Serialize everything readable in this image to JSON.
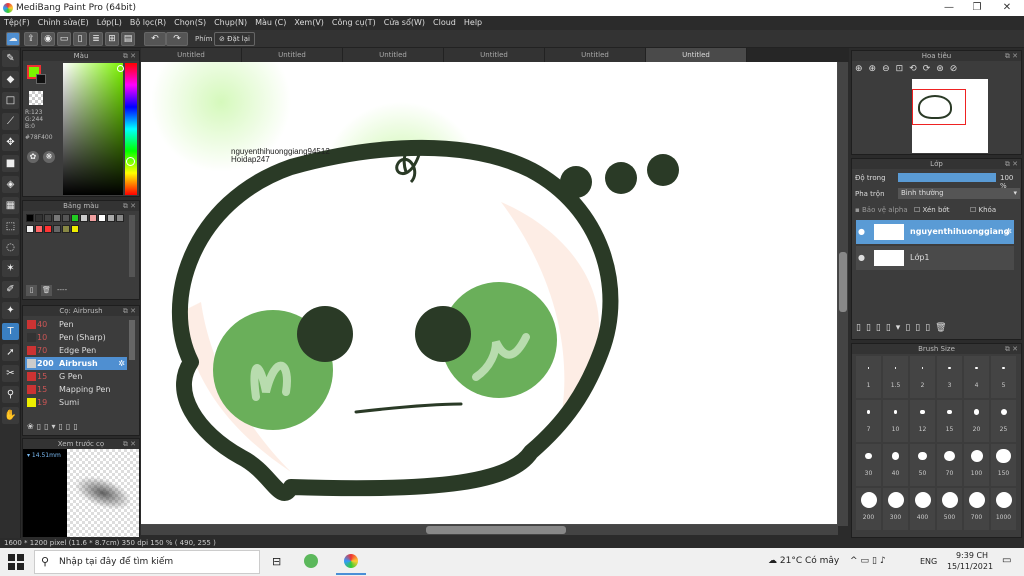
{
  "window": {
    "title": "MediBang Paint Pro (64bit)"
  },
  "menu": [
    "Tệp(F)",
    "Chỉnh sửa(E)",
    "Lớp(L)",
    "Bộ lọc(R)",
    "Chọn(S)",
    "Chụp(N)",
    "Màu (C)",
    "Xem(V)",
    "Công cụ(T)",
    "Cửa sổ(W)",
    "Cloud",
    "Help"
  ],
  "toolbar": {
    "phim_label": "Phím",
    "reset_label": "Đặt lại"
  },
  "tabs": [
    "Untitled",
    "Untitled",
    "Untitled",
    "Untitled",
    "Untitled",
    "Untitled"
  ],
  "color_panel": {
    "title": "Màu",
    "r": "R:123",
    "g": "G:244",
    "b": "B:0",
    "hex": "#78F400",
    "fg_color": "#7bf400"
  },
  "palette_panel": {
    "title": "Bảng màu",
    "swatches": [
      "#000000",
      "#333333",
      "#444444",
      "#777777",
      "#555555",
      "#22cc22",
      "#cccccc",
      "#f0a0a0",
      "#ffffff",
      "#aaaaaa",
      "#888888",
      "#eeeeee",
      "#ff6666",
      "#ff3333",
      "#666666",
      "#888844",
      "#eeee00"
    ],
    "input_value": "----"
  },
  "brush_panel": {
    "title": "Cọ: Airbrush",
    "items": [
      {
        "size": "40",
        "name": "Pen",
        "color": "#cc3333"
      },
      {
        "size": "10",
        "name": "Pen (Sharp)",
        "color": "#333333"
      },
      {
        "size": "70",
        "name": "Edge Pen",
        "color": "#cc3333"
      },
      {
        "size": "200",
        "name": "Airbrush",
        "color": "#cccccc"
      },
      {
        "size": "15",
        "name": "G Pen",
        "color": "#cc3333"
      },
      {
        "size": "15",
        "name": "Mapping Pen",
        "color": "#cc3333"
      },
      {
        "size": "19",
        "name": "Sumi",
        "color": "#eeee00"
      }
    ]
  },
  "preview_panel": {
    "title": "Xem trước cọ",
    "size_label": "14.51mm"
  },
  "navigator_panel": {
    "title": "Hoa tiêu"
  },
  "layer_panel": {
    "title": "Lớp",
    "opacity_label": "Độ trong",
    "opacity_value": "100 %",
    "blend_label": "Pha trộn",
    "blend_value": "Bình thường",
    "protect_alpha": "Bảo vệ alpha",
    "clip_label": "Xén bớt",
    "lock_label": "Khóa",
    "layers": [
      {
        "name": "nguyenthihuonggiang",
        "selected": true
      },
      {
        "name": "Lớp1",
        "selected": false
      }
    ]
  },
  "brushsize_panel": {
    "title": "Brush Size",
    "sizes": [
      "1",
      "1.5",
      "2",
      "3",
      "4",
      "5",
      "7",
      "10",
      "12",
      "15",
      "20",
      "25",
      "30",
      "40",
      "50",
      "70",
      "100",
      "150",
      "200",
      "300",
      "400",
      "500",
      "700",
      "1000"
    ]
  },
  "canvas": {
    "text_line1": "nguyenthihuonggiang94512",
    "text_line2": "Hoidap247"
  },
  "statusbar": {
    "text": "1600 * 1200 pixel   (11.6 * 8.7cm)   350 dpi   150 %   ( 490, 255 )"
  },
  "taskbar": {
    "search_placeholder": "Nhập tại đây để tìm kiếm",
    "weather": "21°C  Có mây",
    "lang": "ENG",
    "time": "9:39 CH",
    "date": "15/11/2021"
  }
}
